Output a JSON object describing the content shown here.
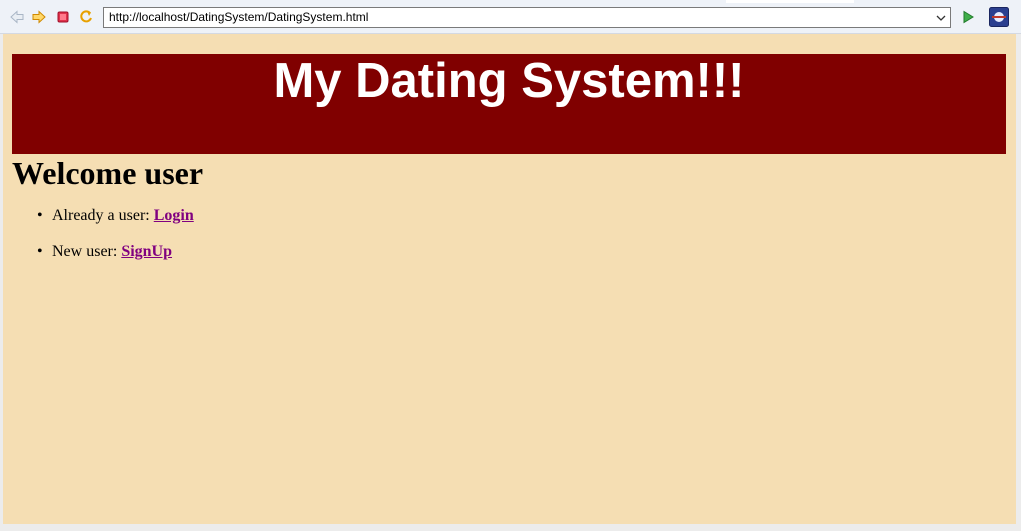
{
  "toolbar": {
    "back_icon": "back-arrow-icon",
    "forward_icon": "forward-arrow-icon",
    "stop_icon": "stop-icon",
    "refresh_icon": "refresh-icon",
    "url": "http://localhost/DatingSystem/DatingSystem.html",
    "go_icon": "go-arrow-icon",
    "browser_icon": "eclipse-browser-icon"
  },
  "page": {
    "banner_title": "My Dating System!!!",
    "heading": "Welcome user",
    "items": [
      {
        "prefix": "Already a user: ",
        "link": "Login"
      },
      {
        "prefix": "New user: ",
        "link": "SignUp"
      }
    ]
  },
  "colors": {
    "background": "#f5deb3",
    "banner": "#800000",
    "link": "#800080"
  }
}
